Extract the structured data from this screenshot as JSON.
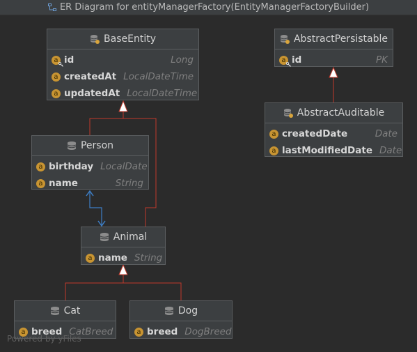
{
  "window": {
    "title": "ER Diagram for entityManagerFactory(EntityManagerFactoryBuilder)"
  },
  "colors": {
    "background": "#2b2b2b",
    "node": "#3c3f41",
    "inheritance_edge": "#c0392b",
    "association_edge": "#3d7ec6",
    "badge": "#c89432"
  },
  "entities": {
    "base_entity": {
      "name": "BaseEntity",
      "fields": [
        {
          "name": "id",
          "type": "Long",
          "badge": "a",
          "key": true
        },
        {
          "name": "createdAt",
          "type": "LocalDateTime",
          "badge": "a",
          "key": false
        },
        {
          "name": "updatedAt",
          "type": "LocalDateTime",
          "badge": "a",
          "key": false
        }
      ]
    },
    "abstract_persistable": {
      "name": "AbstractPersistable",
      "fields": [
        {
          "name": "id",
          "type": "PK",
          "badge": "a",
          "key": true
        }
      ]
    },
    "abstract_auditable": {
      "name": "AbstractAuditable",
      "fields": [
        {
          "name": "createdDate",
          "type": "Date",
          "badge": "a",
          "key": false
        },
        {
          "name": "lastModifiedDate",
          "type": "Date",
          "badge": "a",
          "key": false
        }
      ]
    },
    "person": {
      "name": "Person",
      "fields": [
        {
          "name": "birthday",
          "type": "LocalDate",
          "badge": "a",
          "key": false
        },
        {
          "name": "name",
          "type": "String",
          "badge": "a",
          "key": false
        }
      ]
    },
    "animal": {
      "name": "Animal",
      "fields": [
        {
          "name": "name",
          "type": "String",
          "badge": "a",
          "key": false
        }
      ]
    },
    "cat": {
      "name": "Cat",
      "fields": [
        {
          "name": "breed",
          "type": "CatBreed",
          "badge": "a",
          "key": false
        }
      ]
    },
    "dog": {
      "name": "Dog",
      "fields": [
        {
          "name": "breed",
          "type": "DogBreed",
          "badge": "a",
          "key": false
        }
      ]
    }
  },
  "footer": {
    "watermark": "Powered by yFiles"
  }
}
